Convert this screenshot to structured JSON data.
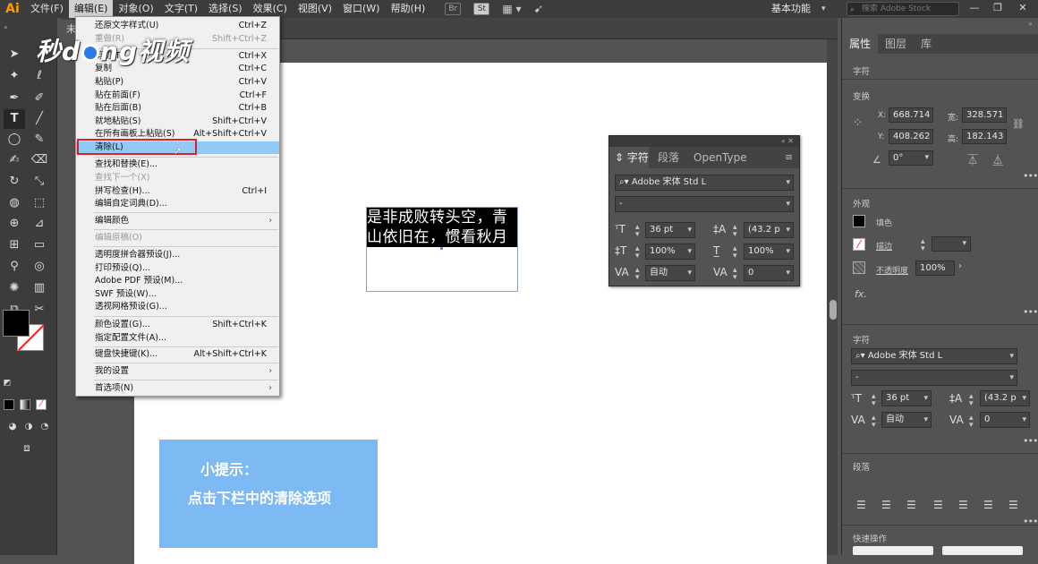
{
  "app": {
    "logo": "Ai"
  },
  "menubar": {
    "items": [
      "文件(F)",
      "编辑(E)",
      "对象(O)",
      "文字(T)",
      "选择(S)",
      "效果(C)",
      "视图(V)",
      "窗口(W)",
      "帮助(H)"
    ],
    "icons": [
      "Br",
      "St"
    ],
    "workspace": "基本功能",
    "search_placeholder": "搜索 Adobe Stock"
  },
  "doc_tab": {
    "label": "未"
  },
  "edit_menu": {
    "items": [
      {
        "label": "还原文字样式(U)",
        "shortcut": "Ctrl+Z",
        "disabled": false
      },
      {
        "label": "重做(R)",
        "shortcut": "Shift+Ctrl+Z",
        "disabled": true
      },
      {
        "label": "剪切(T)",
        "shortcut": "Ctrl+X",
        "disabled": false
      },
      {
        "label": "复制",
        "shortcut": "Ctrl+C",
        "disabled": false
      },
      {
        "label": "粘贴(P)",
        "shortcut": "Ctrl+V",
        "disabled": false
      },
      {
        "label": "贴在前面(F)",
        "shortcut": "Ctrl+F",
        "disabled": false
      },
      {
        "label": "贴在后面(B)",
        "shortcut": "Ctrl+B",
        "disabled": false
      },
      {
        "label": "就地粘贴(S)",
        "shortcut": "Shift+Ctrl+V",
        "disabled": false
      },
      {
        "label": "在所有画板上粘贴(S)",
        "shortcut": "Alt+Shift+Ctrl+V",
        "disabled": false
      },
      {
        "label": "清除(L)",
        "shortcut": "",
        "disabled": false,
        "highlighted": true
      },
      {
        "label": "查找和替换(E)...",
        "shortcut": "",
        "disabled": false
      },
      {
        "label": "查找下一个(X)",
        "shortcut": "",
        "disabled": true
      },
      {
        "label": "拼写检查(H)...",
        "shortcut": "Ctrl+I",
        "disabled": false
      },
      {
        "label": "编辑自定词典(D)...",
        "shortcut": "",
        "disabled": false
      },
      {
        "label": "编辑颜色",
        "shortcut": "",
        "disabled": false,
        "submenu": true
      },
      {
        "label": "编辑原稿(O)",
        "shortcut": "",
        "disabled": true
      },
      {
        "label": "透明度拼合器预设(J)...",
        "shortcut": "",
        "disabled": false
      },
      {
        "label": "打印预设(Q)...",
        "shortcut": "",
        "disabled": false
      },
      {
        "label": "Adobe PDF 预设(M)...",
        "shortcut": "",
        "disabled": false
      },
      {
        "label": "SWF 预设(W)...",
        "shortcut": "",
        "disabled": false
      },
      {
        "label": "透视网格预设(G)...",
        "shortcut": "",
        "disabled": false
      },
      {
        "label": "颜色设置(G)...",
        "shortcut": "Shift+Ctrl+K",
        "disabled": false
      },
      {
        "label": "指定配置文件(A)...",
        "shortcut": "",
        "disabled": false
      },
      {
        "label": "键盘快捷键(K)...",
        "shortcut": "Alt+Shift+Ctrl+K",
        "disabled": false
      },
      {
        "label": "我的设置",
        "shortcut": "",
        "disabled": false,
        "submenu": true
      },
      {
        "label": "首选项(N)",
        "shortcut": "",
        "disabled": false,
        "submenu": true
      }
    ]
  },
  "canvas": {
    "text_lines": [
      "是非成败转头空，青",
      "山依旧在，惯看秋月"
    ]
  },
  "tip": {
    "title": "小提示：",
    "body": "点击下栏中的清除选项"
  },
  "watermark": {
    "text_a": "秒d",
    "text_b": "ng视频"
  },
  "char_panel": {
    "tabs": [
      "字符",
      "段落",
      "OpenType"
    ],
    "font": "Adobe 宋体 Std L",
    "style": "-",
    "size": "36 pt",
    "leading": "(43.2 p",
    "v_scale": "100%",
    "h_scale": "100%",
    "kerning": "自动",
    "tracking": "0"
  },
  "right_panel": {
    "tabs": [
      "属性",
      "图层",
      "库"
    ],
    "section_char": "字符",
    "section_transform": "变换",
    "x_label": "X:",
    "x": "668.714",
    "y_label": "Y:",
    "y": "408.262",
    "w_label": "宽:",
    "w": "328.571",
    "h_label": "高:",
    "h": "182.143",
    "angle": "0°",
    "section_appearance": "外观",
    "fill_label": "填色",
    "stroke_label": "描边",
    "opacity_label": "不透明度",
    "opacity": "100%",
    "fx_label": "fx.",
    "section_char2": "字符",
    "font": "Adobe 宋体 Std L",
    "style": "-",
    "size": "36 pt",
    "leading": "(43.2 p",
    "kerning": "自动",
    "tracking": "0",
    "section_para": "段落",
    "section_quick": "快速操作"
  }
}
